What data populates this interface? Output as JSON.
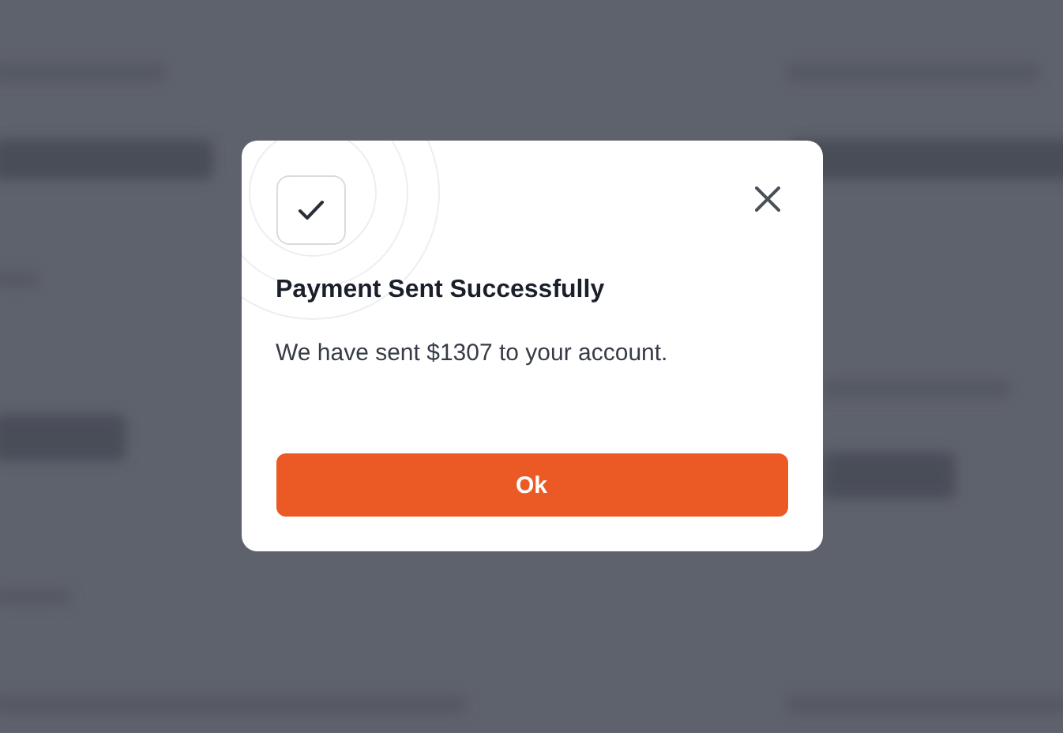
{
  "dialog": {
    "title": "Payment Sent Successfully",
    "message": "We have sent $1307 to your account.",
    "buttons": [
      {
        "label": "Ok",
        "kind": "primary"
      }
    ]
  }
}
